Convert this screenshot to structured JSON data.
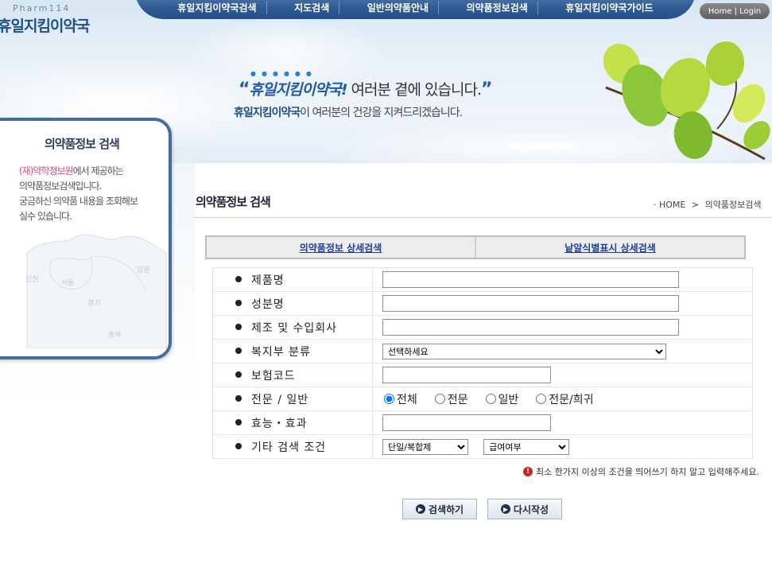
{
  "logo": {
    "sub": "Pharm114",
    "main": "휴일지킴이약국"
  },
  "topnav": {
    "items": [
      {
        "label": "휴일지킴이약국검색"
      },
      {
        "label": "지도검색"
      },
      {
        "label": "일반의약품안내"
      },
      {
        "label": "의약품정보검색"
      },
      {
        "label": "휴일지킴이약국가이드"
      }
    ]
  },
  "login": {
    "label": "Home | Login"
  },
  "banner": {
    "slogan_open": "“",
    "slogan_brand": "휴일지킴이약국",
    "slogan_mark": "!",
    "slogan_text": " 여러분 곁에 있습니다.",
    "slogan_close": "”",
    "slogan2_brand": "휴일지킴이약국",
    "slogan2_text": "이 여러분의 건강을 지켜드리겠습니다."
  },
  "sidebar": {
    "title": "의약품정보 검색",
    "desc_pink": "(재)약학정보원",
    "desc_line1": "에서 제공하는",
    "desc_line2": "의약품정보검색입니다.",
    "desc_line3": "궁금하신 의약품 내용을 조회해보",
    "desc_line4": "실수 있습니다.",
    "map_labels": [
      "인천",
      "서울",
      "경기",
      "강원",
      "충북"
    ]
  },
  "page": {
    "title": "의약품정보 검색",
    "breadcrumb_home": "HOME",
    "breadcrumb_sep": ">",
    "breadcrumb_current": "의약품정보검색"
  },
  "tabs": [
    {
      "label": "의약품정보 상세검색"
    },
    {
      "label": "낱알식별표시 상세검색"
    }
  ],
  "form": {
    "product_name_label": "제품명",
    "ingredient_label": "성분명",
    "manufacturer_label": "제조 및 수입회사",
    "classification_label": "복지부 분류",
    "classification_value": "선택하세요",
    "insurance_code_label": "보험코드",
    "type_label": "전문 / 일반",
    "type_options": [
      "전체",
      "전문",
      "일반",
      "전문/희귀"
    ],
    "type_selected": "전체",
    "efficacy_label": "효능・효과",
    "other_label": "기타 검색 조건",
    "single_combo_value": "단일/복합제",
    "coverage_value": "급여여부"
  },
  "notice": {
    "text": "최소 한가지 이상의 조건을 띄어쓰기 하지 말고 입력해주세요."
  },
  "buttons": {
    "search": "검색하기",
    "reset": "다시작성"
  }
}
